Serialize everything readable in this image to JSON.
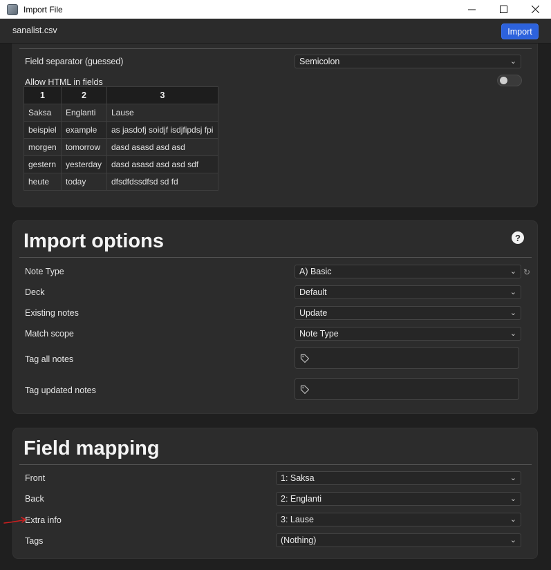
{
  "window": {
    "title": "Import File",
    "minimize_icon": "minimize-icon",
    "maximize_icon": "maximize-icon",
    "close_icon": "close-icon"
  },
  "header": {
    "filename": "sanalist.csv",
    "import_label": "Import"
  },
  "file_options": {
    "separator_label": "Field separator (guessed)",
    "separator_value": "Semicolon",
    "html_label": "Allow HTML in fields",
    "html_enabled": false
  },
  "preview": {
    "headers": [
      "1",
      "2",
      "3"
    ],
    "rows": [
      [
        "Saksa",
        "Englanti",
        "Lause"
      ],
      [
        "beispiel",
        "example",
        "as jasdofj soidjf isdjfipdsj fpi"
      ],
      [
        "morgen",
        "tomorrow",
        "dasd asasd asd asd"
      ],
      [
        "gestern",
        "yesterday",
        "dasd asasd asd asd sdf"
      ],
      [
        "heute",
        "today",
        "dfsdfdssdfsd sd fd"
      ]
    ]
  },
  "import_options": {
    "title": "Import options",
    "help_icon": "help-icon",
    "note_type_label": "Note Type",
    "note_type_value": "A) Basic",
    "deck_label": "Deck",
    "deck_value": "Default",
    "existing_label": "Existing notes",
    "existing_value": "Update",
    "match_label": "Match scope",
    "match_value": "Note Type",
    "tag_all_label": "Tag all notes",
    "tag_updated_label": "Tag updated notes"
  },
  "field_mapping": {
    "title": "Field mapping",
    "rows": [
      {
        "label": "Front",
        "value": "1: Saksa"
      },
      {
        "label": "Back",
        "value": "2: Englanti"
      },
      {
        "label": "Extra info",
        "value": "3: Lause"
      },
      {
        "label": "Tags",
        "value": "(Nothing)"
      }
    ]
  },
  "colors": {
    "accent": "#2d62dc",
    "annotation": "#cc1f1f"
  }
}
